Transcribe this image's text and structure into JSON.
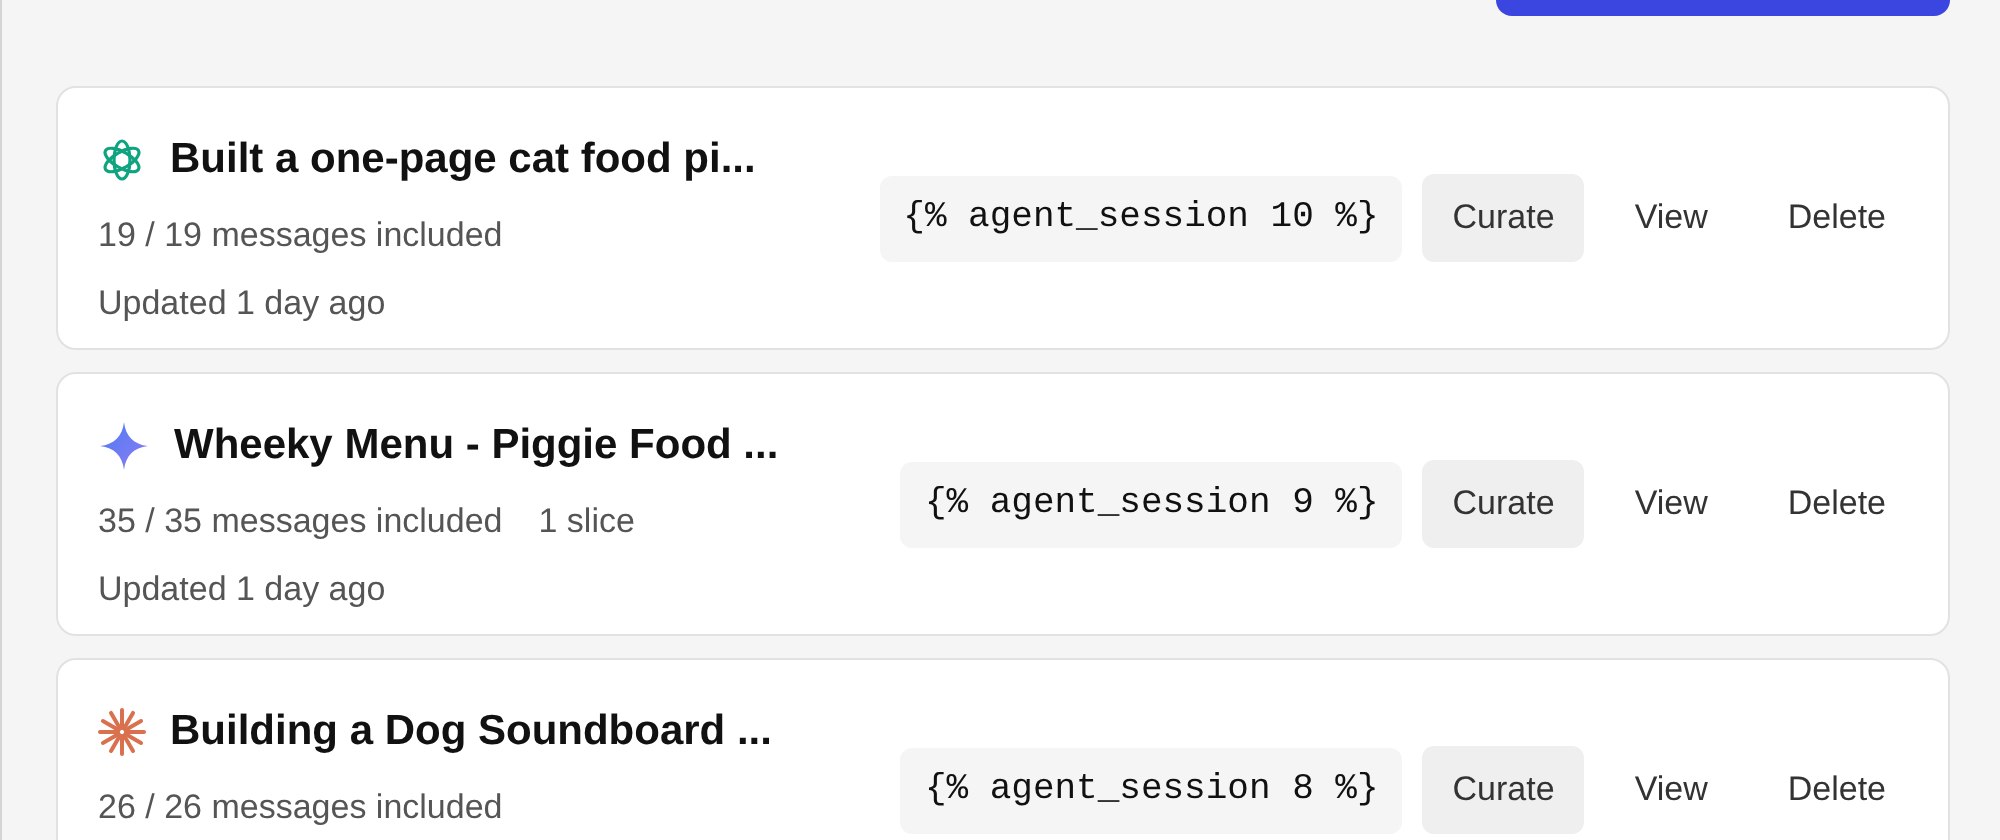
{
  "sessions": [
    {
      "kind": "knot",
      "title": "Built a one-page cat food pi...",
      "messages": "19 / 19 messages included",
      "updated": "Updated 1 day ago",
      "embed": "{% agent_session 10 %}",
      "actions": [
        "Curate",
        "View",
        "Delete"
      ]
    },
    {
      "kind": "sparkle",
      "title": "Wheeky Menu - Piggie Food ...",
      "messages": "35 / 35 messages included",
      "slices": "1 slice",
      "updated": "Updated 1 day ago",
      "embed": "{% agent_session 9 %}",
      "actions": [
        "Curate",
        "View",
        "Delete"
      ]
    },
    {
      "kind": "burst",
      "title": "Building a Dog Soundboard ...",
      "messages": "26 / 26 messages included",
      "embed": "{% agent_session 8 %}",
      "actions": [
        "Curate",
        "View",
        "Delete"
      ]
    }
  ]
}
